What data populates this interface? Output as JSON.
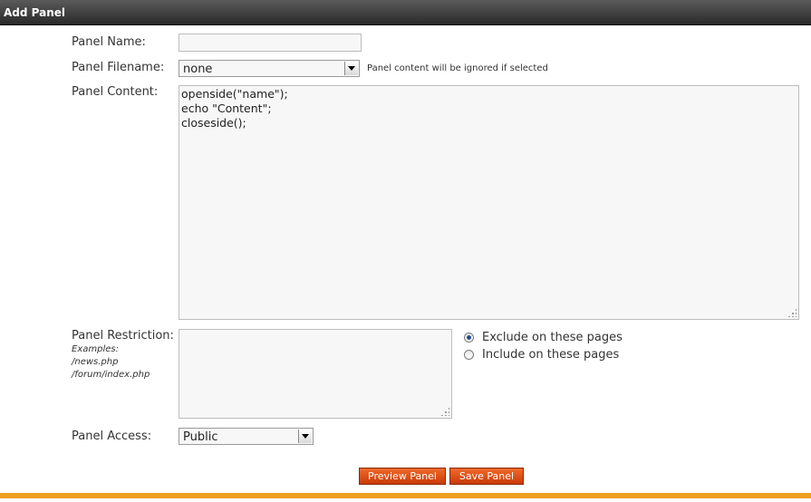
{
  "header": {
    "title": "Add Panel"
  },
  "form": {
    "panel_name": {
      "label": "Panel Name:",
      "value": ""
    },
    "panel_filename": {
      "label": "Panel Filename:",
      "selected": "none",
      "hint": "Panel content will be ignored if selected"
    },
    "panel_content": {
      "label": "Panel Content:",
      "lines": [
        "openside(\"name\");",
        "echo \"Content\";",
        "closeside();"
      ]
    },
    "panel_restriction": {
      "label": "Panel Restriction:",
      "examples": [
        "Examples:",
        "/news.php",
        "/forum/index.php"
      ],
      "value": "",
      "options": [
        {
          "label": "Exclude on these pages",
          "checked": true
        },
        {
          "label": "Include on these pages",
          "checked": false
        }
      ]
    },
    "panel_access": {
      "label": "Panel Access:",
      "selected": "Public"
    }
  },
  "buttons": {
    "preview": "Preview Panel",
    "save": "Save Panel"
  },
  "colors": {
    "header": "#2a2a2a",
    "button": "#e0521a",
    "bottom_bar": "#f0a020"
  }
}
